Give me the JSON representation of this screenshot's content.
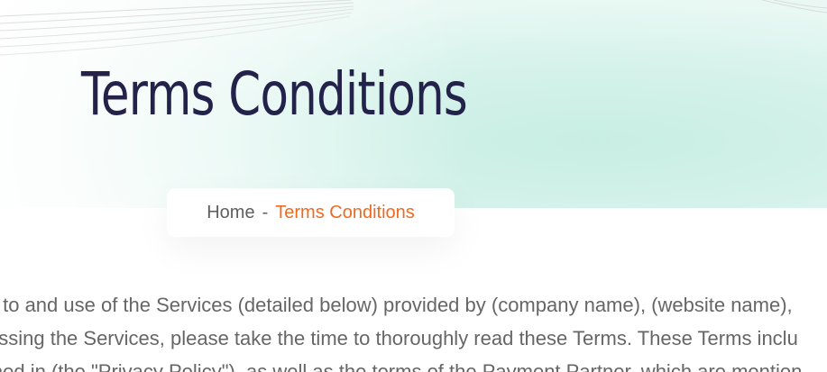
{
  "hero": {
    "title": "Terms Conditions",
    "background_color": "#d4f2ea",
    "title_color": "#23224a"
  },
  "breadcrumb": {
    "home_label": "Home",
    "separator": "-",
    "current_label": "Terms Conditions",
    "current_color": "#ee6a21"
  },
  "content": {
    "lines": [
      "s to and use of the Services (detailed below) provided by (company name), (website name),",
      "essing the Services, please take the time to thoroughly read these Terms. These Terms inclu",
      "ined in (the \"Privacy Policy\"), as well as the terms of the Payment Partner, which are mention"
    ],
    "text_color": "#666666"
  }
}
